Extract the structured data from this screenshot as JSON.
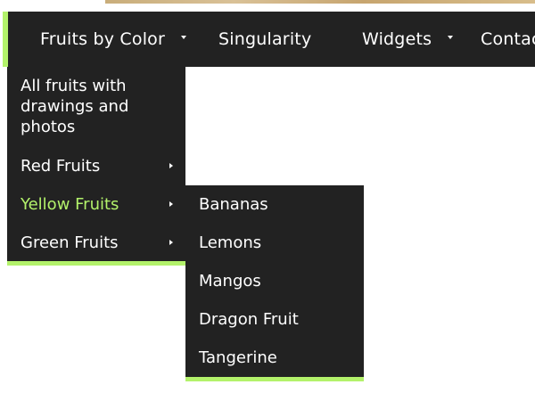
{
  "top_nav": {
    "items": [
      {
        "label": "Fruits by Color",
        "has_dropdown": true
      },
      {
        "label": "Singularity",
        "has_dropdown": false
      },
      {
        "label": "Widgets",
        "has_dropdown": true
      },
      {
        "label": "Contact",
        "has_dropdown": false
      }
    ]
  },
  "fruits_menu": {
    "items": [
      {
        "label": "All fruits with drawings and photos",
        "has_submenu": false,
        "active": false
      },
      {
        "label": "Red Fruits",
        "has_submenu": true,
        "active": false
      },
      {
        "label": "Yellow Fruits",
        "has_submenu": true,
        "active": true
      },
      {
        "label": "Green Fruits",
        "has_submenu": true,
        "active": false
      }
    ]
  },
  "yellow_fruits_menu": {
    "items": [
      {
        "label": "Bananas"
      },
      {
        "label": "Lemons"
      },
      {
        "label": "Mangos"
      },
      {
        "label": "Dragon Fruit"
      },
      {
        "label": "Tangerine"
      }
    ]
  },
  "colors": {
    "nav_background": "#222222",
    "accent": "#b3f26b",
    "text": "#ffffff"
  },
  "icons": {
    "dropdown": "chevron-down-icon",
    "submenu": "chevron-right-icon"
  }
}
